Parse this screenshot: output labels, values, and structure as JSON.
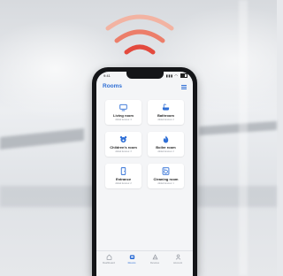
{
  "colors": {
    "accent": "#2f6fd6",
    "wave_outer": "#f2b3a2",
    "wave_middle": "#ec7e6a",
    "wave_inner": "#e34a3e"
  },
  "status_bar": {
    "time": "9:41",
    "signal_text": "▮▮▮ ◠"
  },
  "header": {
    "title": "Rooms",
    "menu_icon": "hamburger-icon"
  },
  "rooms": [
    {
      "name": "Living room",
      "subtitle": "Added devices: 4",
      "icon": "tv-icon"
    },
    {
      "name": "Bathroom",
      "subtitle": "Added devices: 2",
      "icon": "bathtub-icon"
    },
    {
      "name": "Children's room",
      "subtitle": "Added devices: 3",
      "icon": "teddy-bear-icon"
    },
    {
      "name": "Boiler room",
      "subtitle": "Added devices: 2",
      "icon": "flame-icon"
    },
    {
      "name": "Entrance",
      "subtitle": "Added devices: 2",
      "icon": "door-icon"
    },
    {
      "name": "Cleaning room",
      "subtitle": "Added devices: 1",
      "icon": "washing-machine-icon"
    }
  ],
  "tabs": [
    {
      "label": "Dashboard",
      "icon": "home-icon",
      "active": false
    },
    {
      "label": "Rooms",
      "icon": "rooms-icon",
      "active": true
    },
    {
      "label": "Devices",
      "icon": "devices-icon",
      "active": false
    },
    {
      "label": "Account",
      "icon": "user-icon",
      "active": false
    }
  ]
}
